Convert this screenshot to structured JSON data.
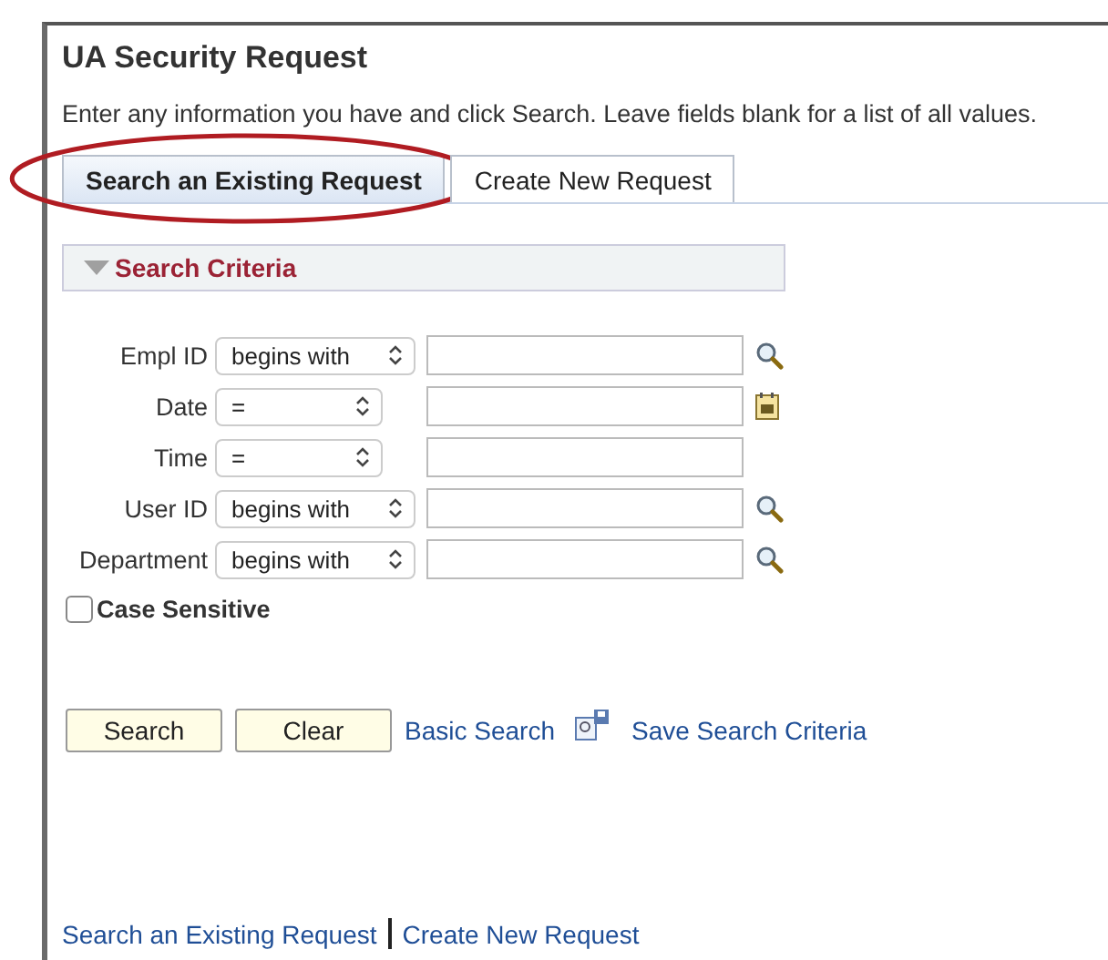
{
  "page": {
    "title": "UA Security Request",
    "instructions": "Enter any information you have and click Search. Leave fields blank for a list of all values."
  },
  "tabs": [
    {
      "label": "Search an Existing Request",
      "selected": true,
      "highlighted": true
    },
    {
      "label": "Create New Request",
      "selected": false,
      "highlighted": false
    }
  ],
  "section": {
    "title": "Search Criteria",
    "expanded": true
  },
  "fields": [
    {
      "label": "Empl ID",
      "operator": "begins with",
      "kind": "lookup"
    },
    {
      "label": "Date",
      "operator": "=",
      "kind": "calendar"
    },
    {
      "label": "Time",
      "operator": "=",
      "kind": "plain"
    },
    {
      "label": "User ID",
      "operator": "begins with",
      "kind": "lookup"
    },
    {
      "label": "Department",
      "operator": "begins with",
      "kind": "lookup"
    }
  ],
  "case_sensitive": {
    "label": "Case Sensitive",
    "checked": false
  },
  "buttons": [
    "Search",
    "Clear"
  ],
  "links": [
    "Basic Search",
    "Save Search Criteria"
  ],
  "footer_links": [
    "Search an Existing Request",
    "Create New Request"
  ]
}
